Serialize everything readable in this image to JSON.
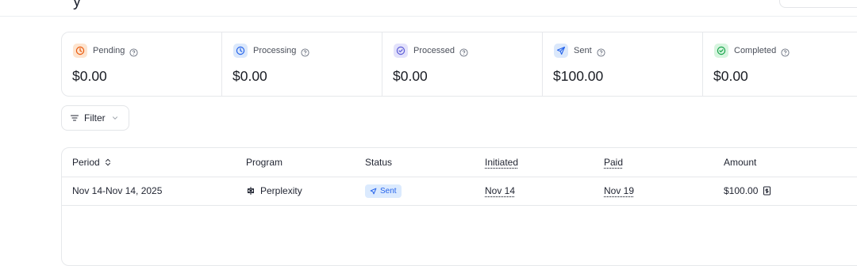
{
  "header": {
    "title_glyph": "y"
  },
  "stats": [
    {
      "label": "Pending",
      "value": "$0.00",
      "icon": "clock-icon",
      "icon_bg": "#fde4cf",
      "icon_color": "#ea580c"
    },
    {
      "label": "Processing",
      "value": "$0.00",
      "icon": "clock-icon",
      "icon_bg": "#dbe8fb",
      "icon_color": "#2563eb"
    },
    {
      "label": "Processed",
      "value": "$0.00",
      "icon": "check-circle-icon",
      "icon_bg": "#e3e2fb",
      "icon_color": "#5b5bd6"
    },
    {
      "label": "Sent",
      "value": "$100.00",
      "icon": "send-icon",
      "icon_bg": "#dbe8fb",
      "icon_color": "#2563eb"
    },
    {
      "label": "Completed",
      "value": "$0.00",
      "icon": "check-circle-icon",
      "icon_bg": "#d7f5df",
      "icon_color": "#16a34a"
    }
  ],
  "filter": {
    "label": "Filter"
  },
  "table": {
    "columns": [
      "Period",
      "Program",
      "Status",
      "Initiated",
      "Paid",
      "Amount"
    ],
    "rows": [
      {
        "period": "Nov 14-Nov 14, 2025",
        "program": "Perplexity",
        "status": "Sent",
        "initiated": "Nov 14",
        "paid": "Nov 19",
        "amount": "$100.00"
      }
    ]
  },
  "colors": {
    "status_sent_bg": "#dbeafe",
    "status_sent_text": "#2563eb"
  }
}
